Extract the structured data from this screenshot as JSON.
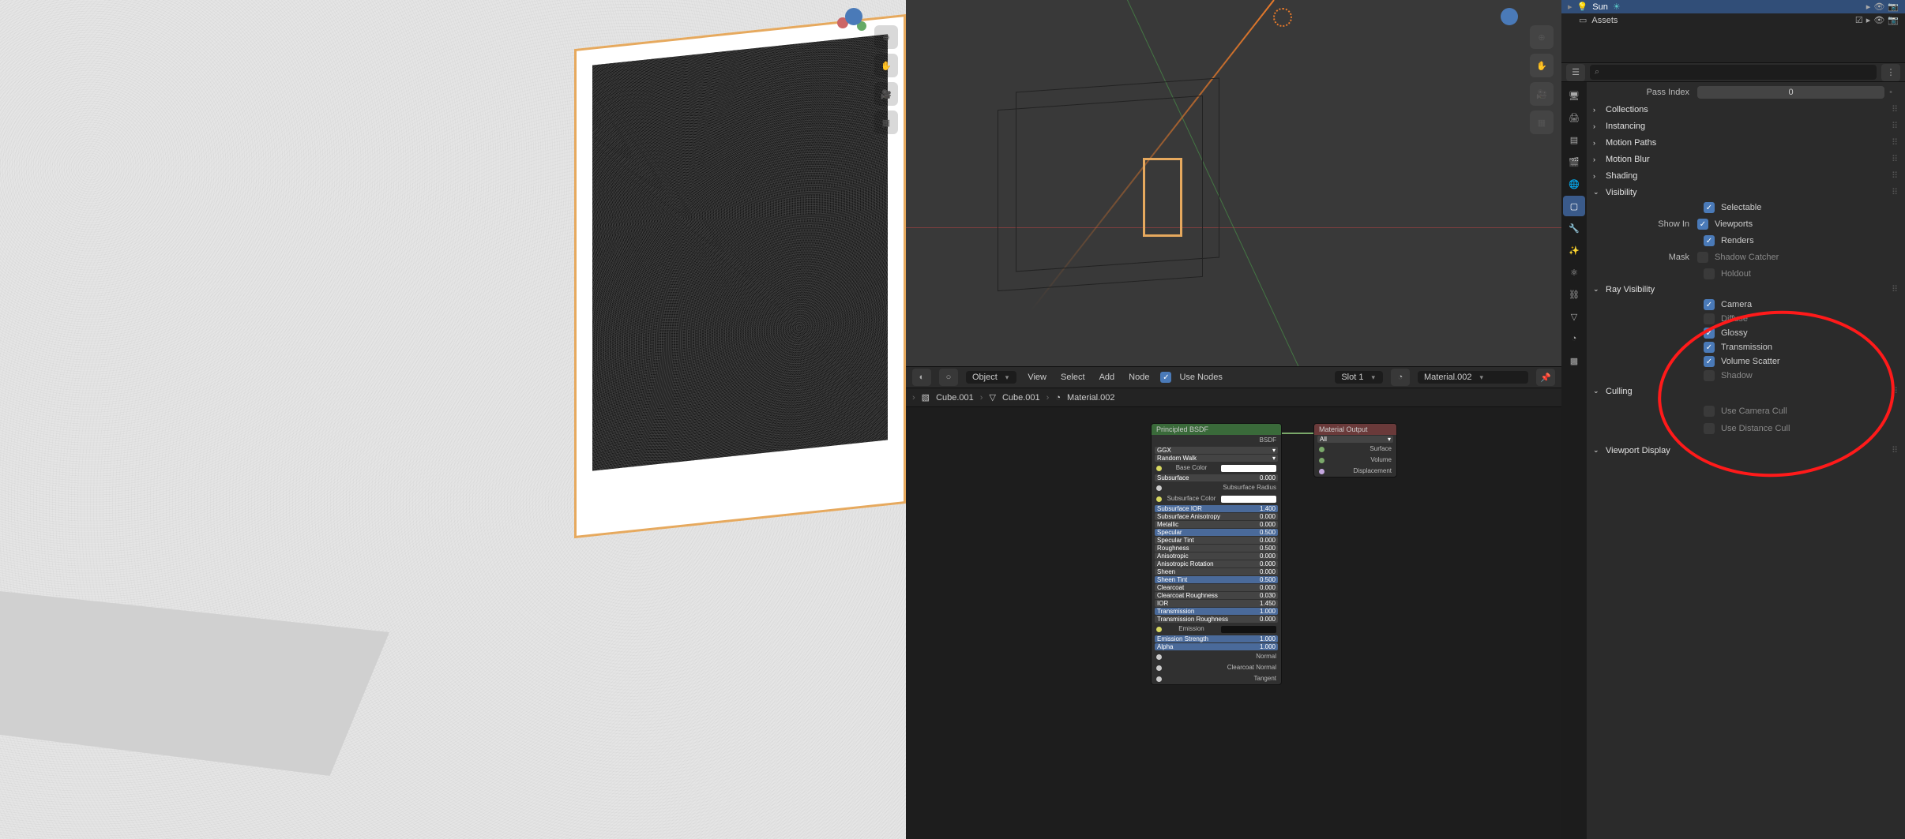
{
  "outliner": {
    "items": [
      {
        "name": "Sun",
        "type": "light",
        "selected": true
      },
      {
        "name": "Assets",
        "type": "collection",
        "selected": false
      }
    ]
  },
  "header": {
    "mode": "Object",
    "menus": [
      "View",
      "Select",
      "Add",
      "Node"
    ],
    "use_nodes_label": "Use Nodes",
    "slot": "Slot 1",
    "material": "Material.002"
  },
  "breadcrumb": {
    "obj": "Cube.001",
    "mesh": "Cube.001",
    "mat": "Material.002"
  },
  "nodes": {
    "bsdf": {
      "title": "Principled BSDF",
      "out": "BSDF",
      "dist": "GGX",
      "sss_method": "Random Walk",
      "rows": [
        {
          "label": "Base Color",
          "type": "swatch"
        },
        {
          "label": "Subsurface",
          "val": "0.000"
        },
        {
          "label": "Subsurface Radius",
          "type": "dropdown"
        },
        {
          "label": "Subsurface Color",
          "type": "swatch"
        },
        {
          "label": "Subsurface IOR",
          "val": "1.400",
          "hl": true
        },
        {
          "label": "Subsurface Anisotropy",
          "val": "0.000"
        },
        {
          "label": "Metallic",
          "val": "0.000"
        },
        {
          "label": "Specular",
          "val": "0.500",
          "hl": true
        },
        {
          "label": "Specular Tint",
          "val": "0.000"
        },
        {
          "label": "Roughness",
          "val": "0.500"
        },
        {
          "label": "Anisotropic",
          "val": "0.000"
        },
        {
          "label": "Anisotropic Rotation",
          "val": "0.000"
        },
        {
          "label": "Sheen",
          "val": "0.000"
        },
        {
          "label": "Sheen Tint",
          "val": "0.500",
          "hl": true
        },
        {
          "label": "Clearcoat",
          "val": "0.000"
        },
        {
          "label": "Clearcoat Roughness",
          "val": "0.030"
        },
        {
          "label": "IOR",
          "val": "1.450"
        },
        {
          "label": "Transmission",
          "val": "1.000",
          "hl": true
        },
        {
          "label": "Transmission Roughness",
          "val": "0.000"
        },
        {
          "label": "Emission",
          "type": "swatch",
          "dark": true
        },
        {
          "label": "Emission Strength",
          "val": "1.000",
          "hl": true
        },
        {
          "label": "Alpha",
          "val": "1.000",
          "hl": true
        },
        {
          "label": "Normal",
          "type": "in"
        },
        {
          "label": "Clearcoat Normal",
          "type": "in"
        },
        {
          "label": "Tangent",
          "type": "in"
        }
      ]
    },
    "output": {
      "title": "Material Output",
      "target": "All",
      "sockets": [
        "Surface",
        "Volume",
        "Displacement"
      ]
    }
  },
  "properties": {
    "search_placeholder": "",
    "pass_index": {
      "label": "Pass Index",
      "value": "0"
    },
    "panels_collapsed": [
      "Collections",
      "Instancing",
      "Motion Paths",
      "Motion Blur",
      "Shading"
    ],
    "visibility": {
      "title": "Visibility",
      "selectable": {
        "label": "Selectable",
        "on": true
      },
      "show_in_label": "Show In",
      "viewports": {
        "label": "Viewports",
        "on": true
      },
      "renders": {
        "label": "Renders",
        "on": true
      },
      "mask_label": "Mask",
      "shadow_catcher": {
        "label": "Shadow Catcher",
        "on": false
      },
      "holdout": {
        "label": "Holdout",
        "on": false
      }
    },
    "ray_visibility": {
      "title": "Ray Visibility",
      "items": [
        {
          "label": "Camera",
          "on": true
        },
        {
          "label": "Diffuse",
          "on": false
        },
        {
          "label": "Glossy",
          "on": true
        },
        {
          "label": "Transmission",
          "on": true
        },
        {
          "label": "Volume Scatter",
          "on": true
        },
        {
          "label": "Shadow",
          "on": false
        }
      ]
    },
    "culling": {
      "title": "Culling",
      "camera": {
        "label": "Use Camera Cull",
        "on": false
      },
      "distance": {
        "label": "Use Distance Cull",
        "on": false
      }
    },
    "viewport_display": {
      "title": "Viewport Display"
    }
  },
  "icons": {
    "search": "⌕",
    "zoom": "⊕",
    "pan": "✋",
    "camera": "🎥",
    "grid": "▦",
    "light": "💡",
    "sun": "☀",
    "collection": "▭",
    "eye": "👁",
    "render": "📷",
    "arrow": "▸",
    "filter": "⋮",
    "check": "✓",
    "chev_down": "⌄",
    "chev_right": "›"
  }
}
